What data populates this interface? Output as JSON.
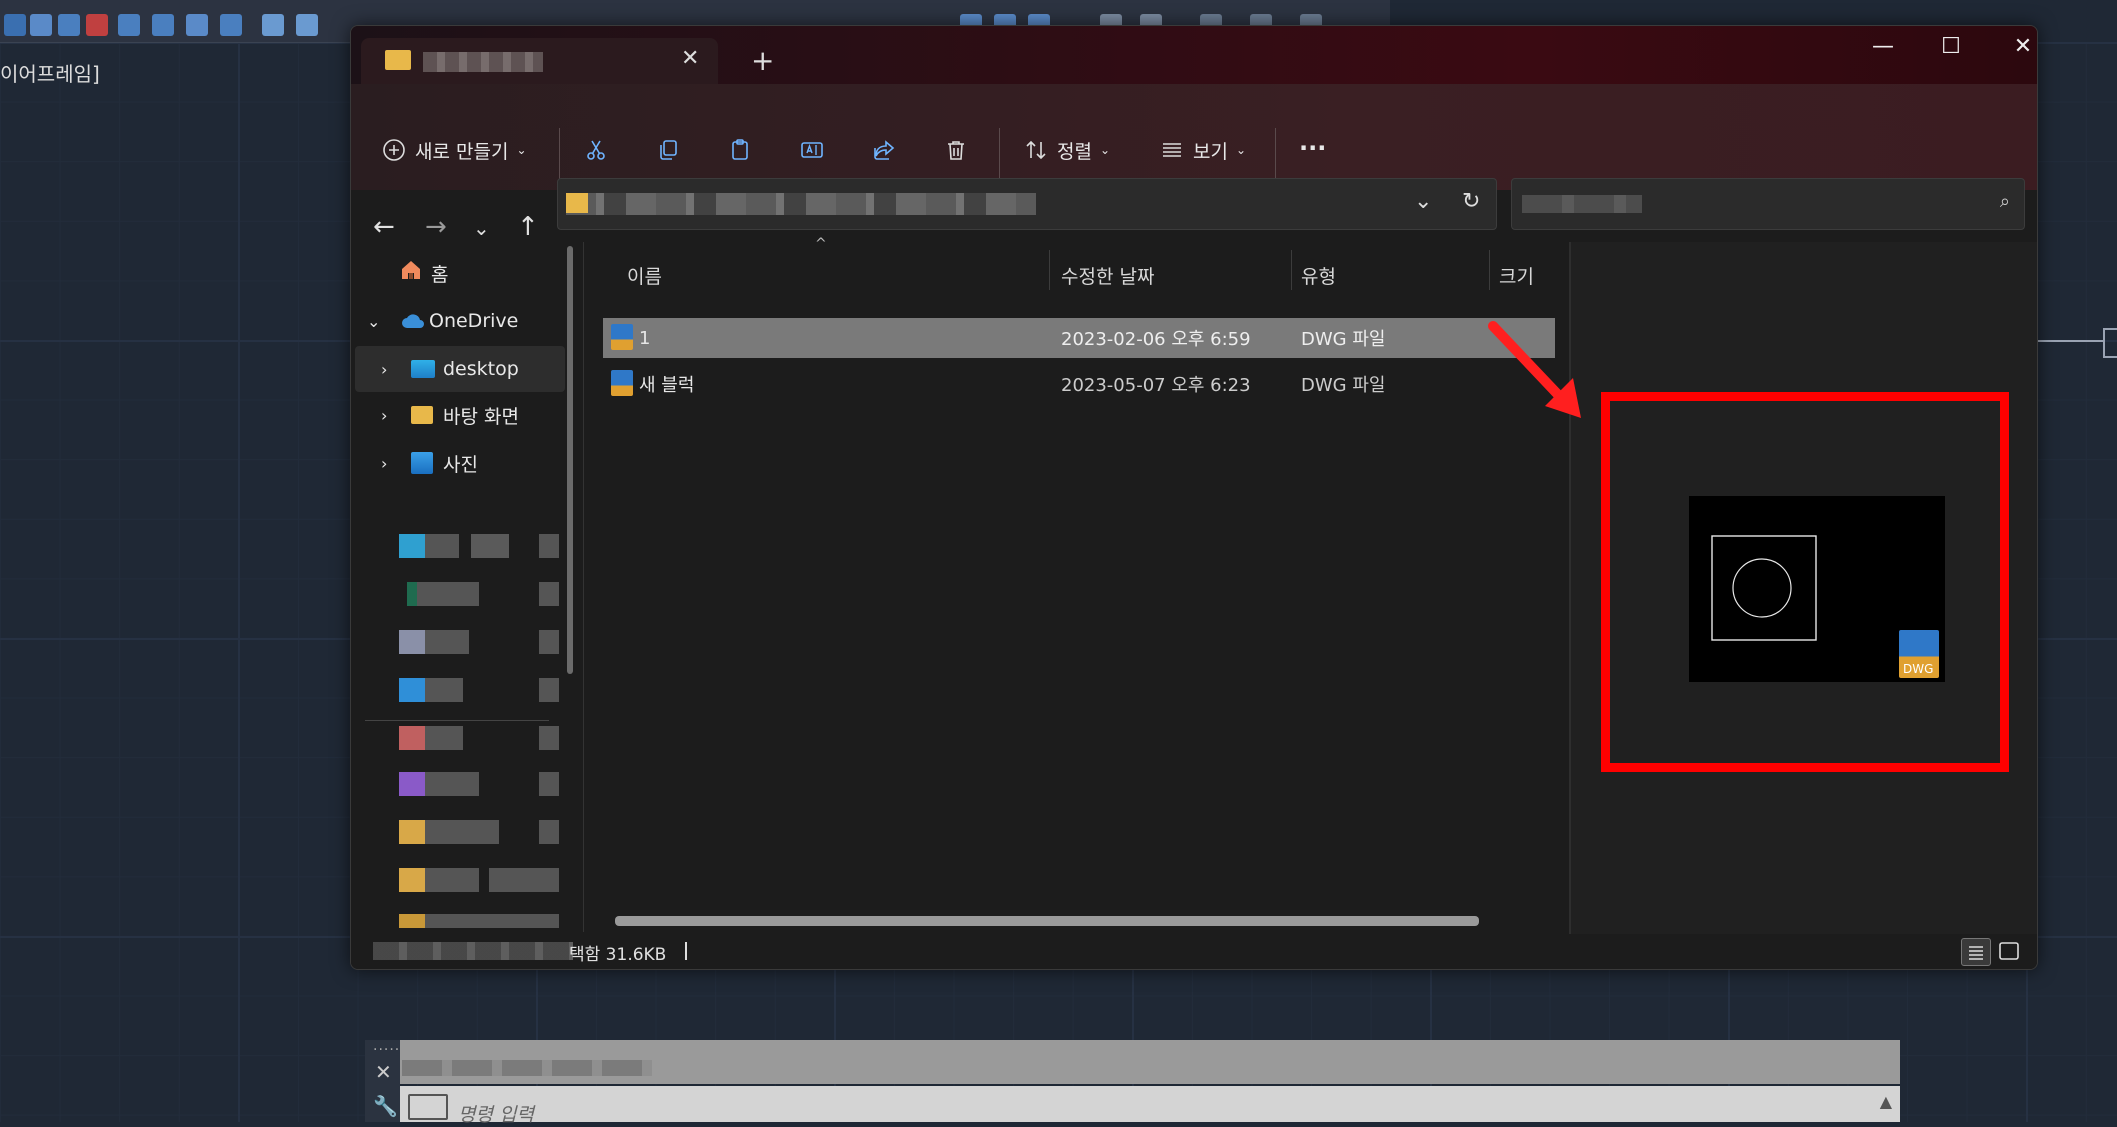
{
  "background_app": {
    "viewport_label": "이어프레임]",
    "command_placeholder": "명령 입력"
  },
  "explorer": {
    "tab_close": "✕",
    "tab_add": "+",
    "window_controls": {
      "minimize": "—",
      "maximize": "☐",
      "close": "✕"
    },
    "toolbar": {
      "new_label": "새로 만들기",
      "sort_label": "정렬",
      "view_label": "보기",
      "more_label": "···"
    },
    "nav": {
      "home": "홈",
      "onedrive": "OneDrive",
      "desktop": "desktop",
      "desktop_ko": "바탕 화면",
      "photos": "사진"
    },
    "columns": {
      "name": "이름",
      "modified": "수정한 날짜",
      "type": "유형",
      "size": "크기"
    },
    "files": [
      {
        "name": "1",
        "modified": "2023-02-06 오후 6:59",
        "type": "DWG 파일",
        "selected": true
      },
      {
        "name": "새 블럭",
        "modified": "2023-05-07 오후 6:23",
        "type": "DWG 파일",
        "selected": false
      }
    ],
    "preview": {
      "badge_text": "DWG"
    },
    "status": {
      "text": "택함 31.6KB"
    }
  },
  "colors": {
    "highlight": "#ff0000",
    "folder": "#e8b84a",
    "onedrive": "#3a8fd8"
  }
}
